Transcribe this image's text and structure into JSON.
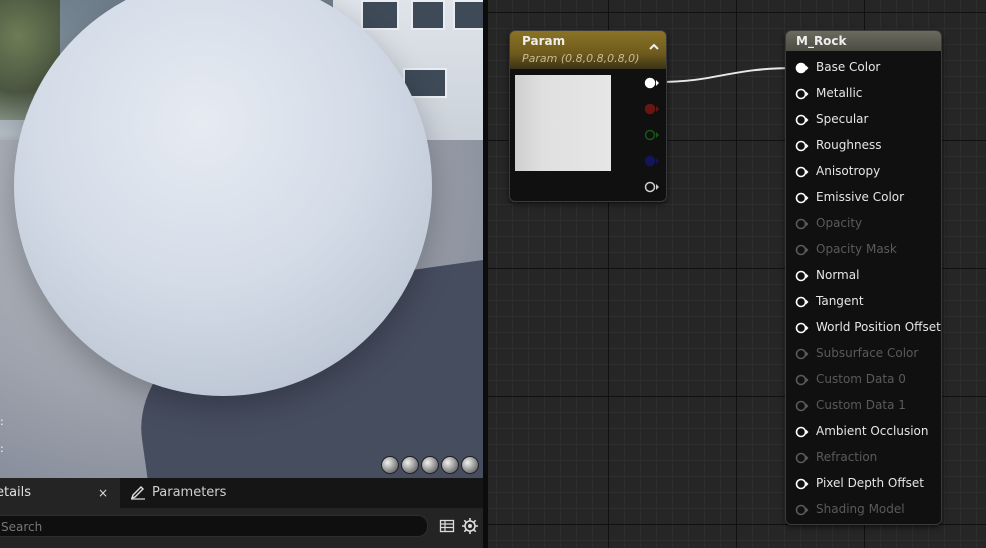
{
  "details_panel": {
    "tabs": [
      {
        "label": "etails",
        "close": "×"
      },
      {
        "label": "Parameters"
      }
    ],
    "search": {
      "placeholder": "Search"
    }
  },
  "viewport": {
    "side_marks": [
      ":",
      ":"
    ],
    "preview_icons": [
      "cylinder-preview-icon",
      "sphere-preview-icon",
      "plane-preview-icon",
      "cube-preview-icon",
      "custom-mesh-preview-icon"
    ]
  },
  "graph": {
    "param_node": {
      "title": "Param",
      "subtitle": "Param (0.8,0.8,0.8,0)",
      "color": "#cccccc",
      "outputs": [
        {
          "name": "rgb-output-pin",
          "color": "#ffffff",
          "connected": true
        },
        {
          "name": "red-output-pin",
          "color": "#6b1414",
          "connected": false
        },
        {
          "name": "green-output-pin",
          "color": "#145a14",
          "connected": false
        },
        {
          "name": "blue-output-pin",
          "color": "#14145a",
          "connected": false
        },
        {
          "name": "alpha-output-pin",
          "color": "#cfcfcf",
          "connected": false
        }
      ]
    },
    "material_node": {
      "title": "M_Rock",
      "inputs": [
        {
          "label": "Base Color",
          "enabled": true,
          "connected": true
        },
        {
          "label": "Metallic",
          "enabled": true,
          "connected": false
        },
        {
          "label": "Specular",
          "enabled": true,
          "connected": false
        },
        {
          "label": "Roughness",
          "enabled": true,
          "connected": false
        },
        {
          "label": "Anisotropy",
          "enabled": true,
          "connected": false
        },
        {
          "label": "Emissive Color",
          "enabled": true,
          "connected": false
        },
        {
          "label": "Opacity",
          "enabled": false,
          "connected": false
        },
        {
          "label": "Opacity Mask",
          "enabled": false,
          "connected": false
        },
        {
          "label": "Normal",
          "enabled": true,
          "connected": false
        },
        {
          "label": "Tangent",
          "enabled": true,
          "connected": false
        },
        {
          "label": "World Position Offset",
          "enabled": true,
          "connected": false
        },
        {
          "label": "Subsurface Color",
          "enabled": false,
          "connected": false
        },
        {
          "label": "Custom Data 0",
          "enabled": false,
          "connected": false
        },
        {
          "label": "Custom Data 1",
          "enabled": false,
          "connected": false
        },
        {
          "label": "Ambient Occlusion",
          "enabled": true,
          "connected": false
        },
        {
          "label": "Refraction",
          "enabled": false,
          "connected": false
        },
        {
          "label": "Pixel Depth Offset",
          "enabled": true,
          "connected": false
        },
        {
          "label": "Shading Model",
          "enabled": false,
          "connected": false
        }
      ]
    },
    "wire_color": "#e8e8e8"
  }
}
